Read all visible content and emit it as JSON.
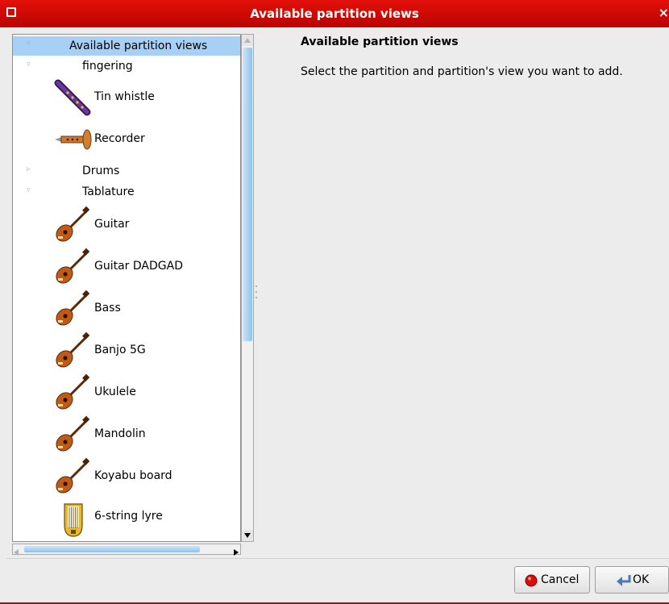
{
  "window": {
    "title": "Available partition views",
    "close_glyph": "×"
  },
  "tree": {
    "items": [
      {
        "label": "Available partition views",
        "level": 0,
        "expanded": true,
        "selected": true
      },
      {
        "label": "fingering",
        "level": 1,
        "expanded": true
      },
      {
        "label": "Tin whistle",
        "level": 2,
        "icon": "tin-whistle-icon"
      },
      {
        "label": "Recorder",
        "level": 2,
        "icon": "recorder-icon"
      },
      {
        "label": "Drums",
        "level": 1,
        "expanded": false
      },
      {
        "label": "Tablature",
        "level": 1,
        "expanded": true
      },
      {
        "label": "Guitar",
        "level": 2,
        "icon": "guitar-icon"
      },
      {
        "label": "Guitar DADGAD",
        "level": 2,
        "icon": "guitar-icon"
      },
      {
        "label": "Bass",
        "level": 2,
        "icon": "guitar-icon"
      },
      {
        "label": "Banjo 5G",
        "level": 2,
        "icon": "guitar-icon"
      },
      {
        "label": "Ukulele",
        "level": 2,
        "icon": "guitar-icon"
      },
      {
        "label": "Mandolin",
        "level": 2,
        "icon": "guitar-icon"
      },
      {
        "label": "Koyabu board",
        "level": 2,
        "icon": "guitar-icon"
      },
      {
        "label": "6-string lyre",
        "level": 2,
        "icon": "lyre-icon"
      }
    ]
  },
  "panel": {
    "title": "Available partition views",
    "description": "Select the partition and partition's view you want to add."
  },
  "buttons": {
    "cancel": "Cancel",
    "ok": "OK"
  },
  "colors": {
    "titlebar": "#d40a04",
    "selection": "#a8cff4",
    "expander": "#7fb4e8"
  }
}
